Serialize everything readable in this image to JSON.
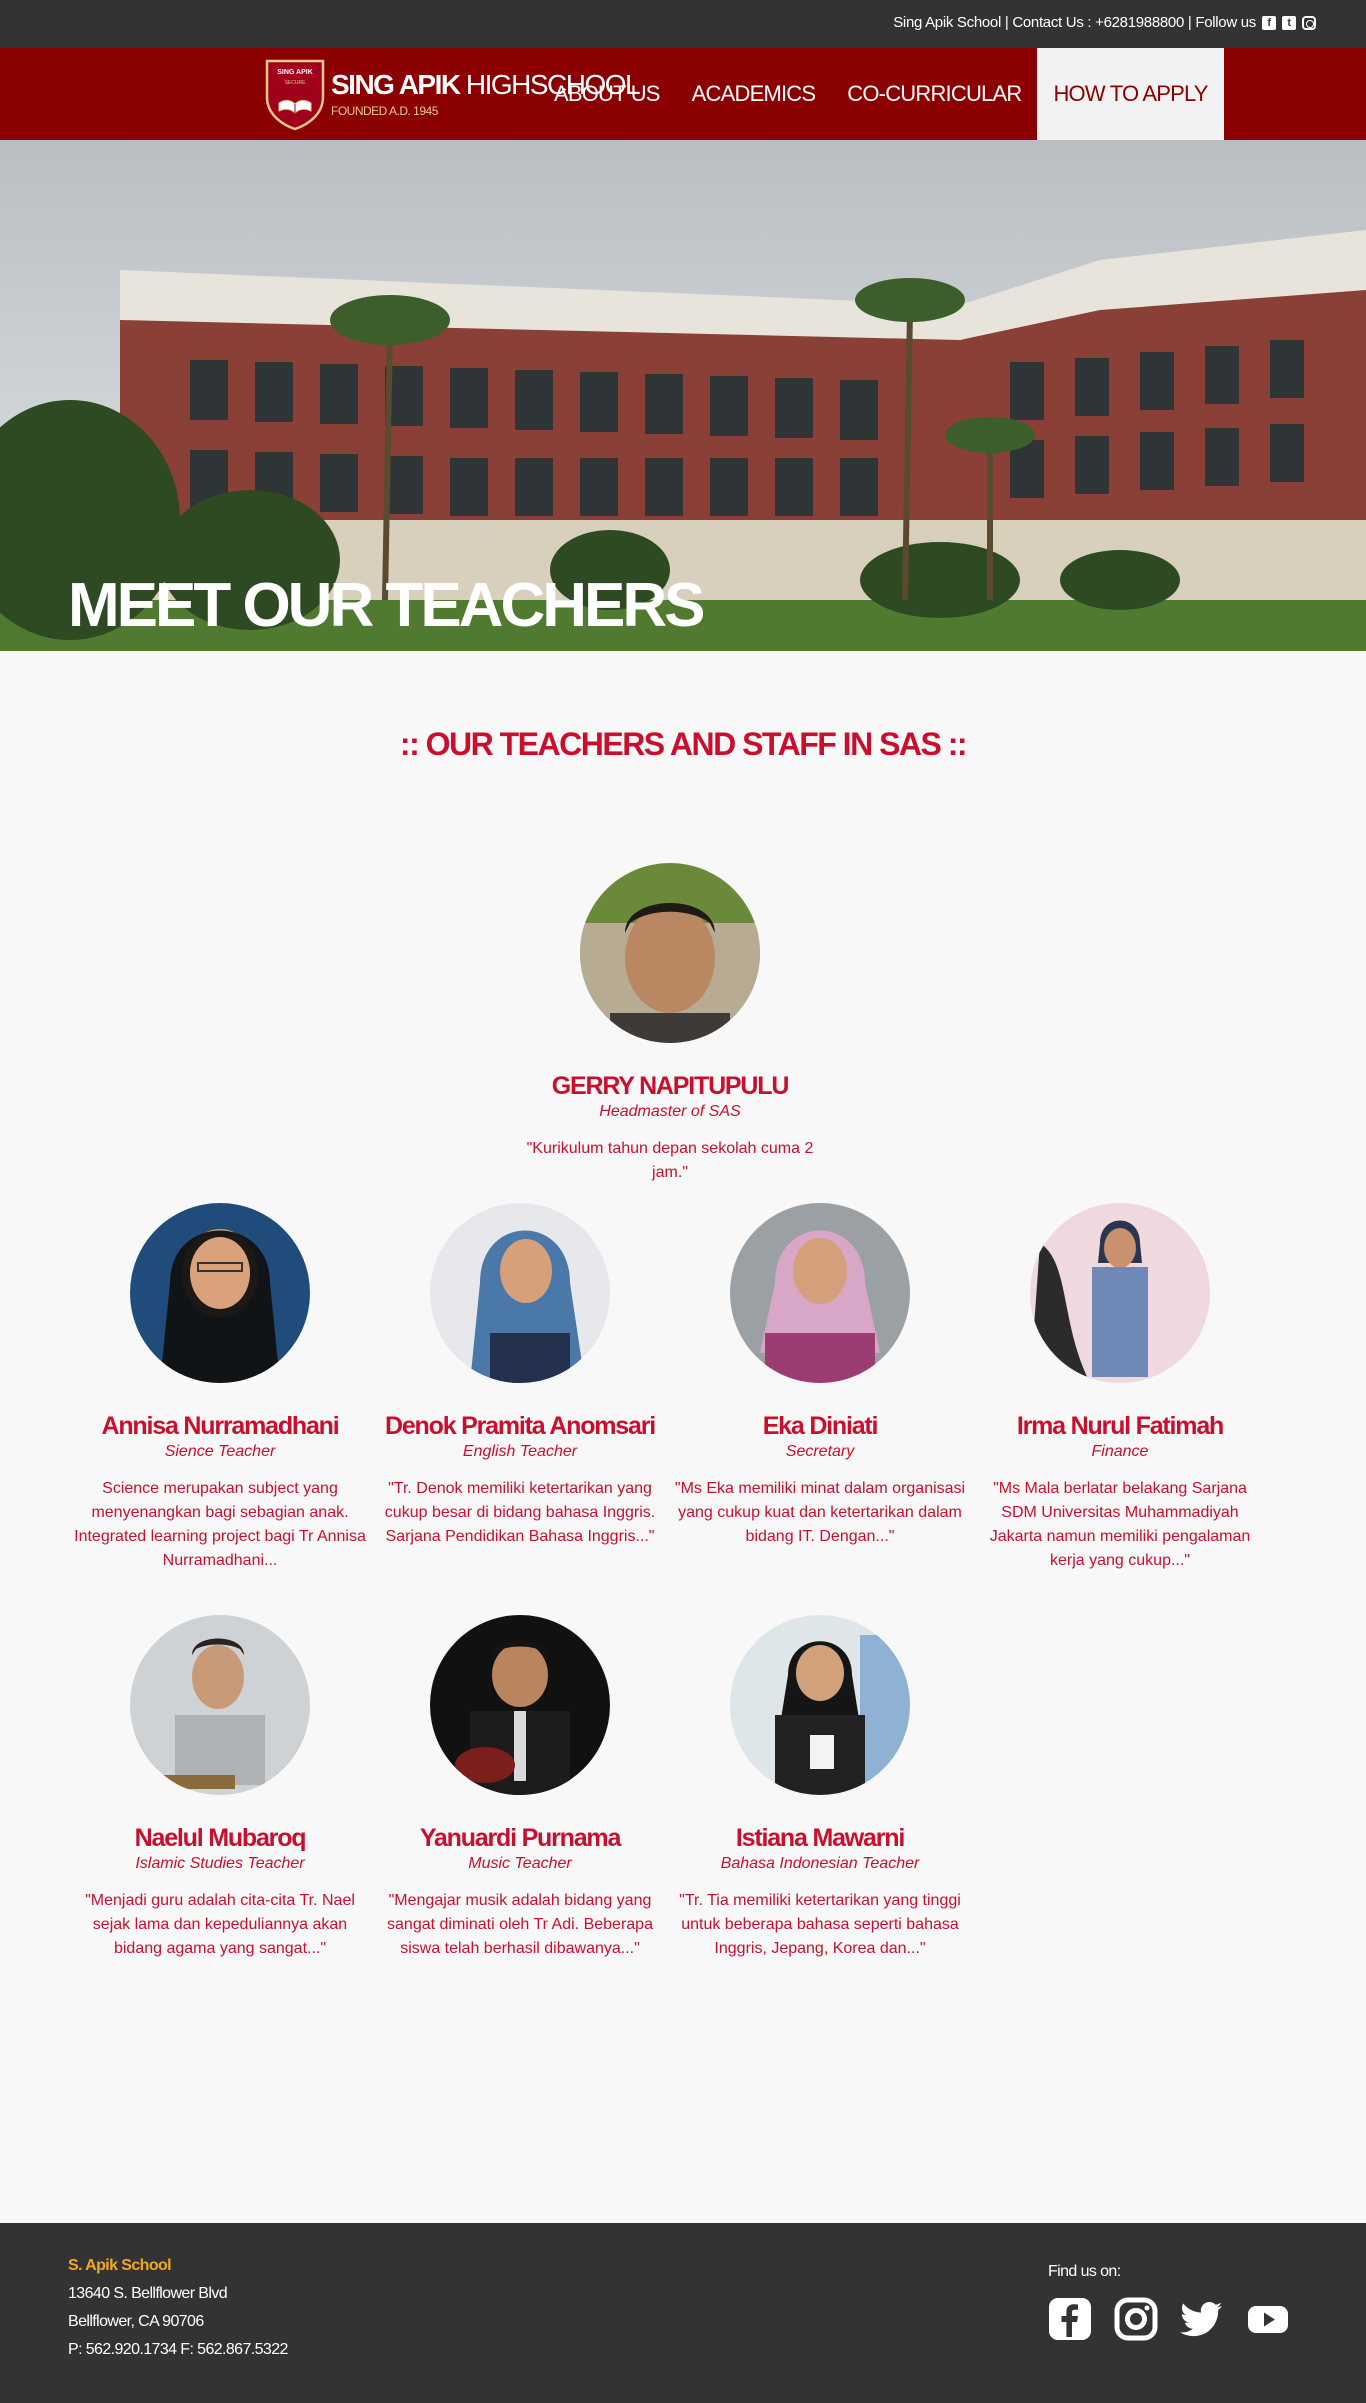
{
  "topbar": {
    "text": "Sing Apik School | Contact Us : +6281988800 | Follow us"
  },
  "header": {
    "logo": {
      "shield_text_top": "SING APIK",
      "shield_text_bottom": "SECURE",
      "title_bold": "SING APIK",
      "title_light": " HIGHSCHOOL",
      "founded": "FOUNDED A.D. 1945"
    },
    "nav": [
      {
        "label": "ABOUT US"
      },
      {
        "label": "ACADEMICS"
      },
      {
        "label": "CO-CURRICULAR"
      },
      {
        "label": "HOW TO APPLY",
        "active": true
      }
    ]
  },
  "hero": {
    "title": "MEET OUR TEACHERS"
  },
  "section": {
    "heading": ":: OUR TEACHERS AND STAFF IN SAS ::"
  },
  "headmaster": {
    "name": "GERRY NAPITUPULU",
    "role": "Headmaster of SAS",
    "quote": "\"Kurikulum tahun depan sekolah cuma 2 jam.\""
  },
  "teachers": [
    {
      "name": "Annisa Nurramadhani",
      "role": "Sience Teacher",
      "quote": "Science merupakan subject yang menyenangkan bagi sebagian anak. Integrated learning project bagi Tr Annisa Nurramadhani..."
    },
    {
      "name": "Denok Pramita Anomsari",
      "role": "English Teacher",
      "quote": "\"Tr. Denok memiliki ketertarikan yang cukup besar di bidang bahasa Inggris. Sarjana Pendidikan Bahasa Inggris...\""
    },
    {
      "name": "Eka Diniati",
      "role": "Secretary",
      "quote": "\"Ms Eka memiliki minat dalam organisasi yang cukup kuat dan ketertarikan dalam bidang IT. Dengan...\""
    },
    {
      "name": "Irma Nurul Fatimah",
      "role": "Finance",
      "quote": "\"Ms Mala berlatar belakang Sarjana SDM Universitas Muhammadiyah Jakarta namun memiliki pengalaman kerja yang cukup...\""
    },
    {
      "name": "Naelul Mubaroq",
      "role": "Islamic Studies Teacher",
      "quote": "\"Menjadi guru adalah cita-cita Tr. Nael sejak lama dan kepeduliannya akan bidang agama yang sangat...\""
    },
    {
      "name": "Yanuardi Purnama",
      "role": "Music Teacher",
      "quote": "\"Mengajar musik adalah bidang yang sangat diminati oleh Tr Adi. Beberapa siswa telah berhasil dibawanya...\""
    },
    {
      "name": "Istiana Mawarni",
      "role": "Bahasa Indonesian Teacher",
      "quote": "\"Tr. Tia memiliki ketertarikan yang tinggi untuk beberapa bahasa seperti bahasa Inggris, Jepang, Korea dan...\""
    }
  ],
  "footer": {
    "school": "S. Apik School",
    "address1": "13640 S. Bellflower Blvd",
    "address2": "Bellflower, CA 90706",
    "phone": "P: 562.920.1734 F: 562.867.5322",
    "find_us": "Find us on:",
    "social_icons": [
      "facebook-icon",
      "instagram-icon",
      "twitter-icon",
      "youtube-icon"
    ]
  },
  "colors": {
    "topbar": "#333333",
    "nav": "#8b0000",
    "accent": "#c8102e",
    "footer_brand": "#f5a623"
  }
}
